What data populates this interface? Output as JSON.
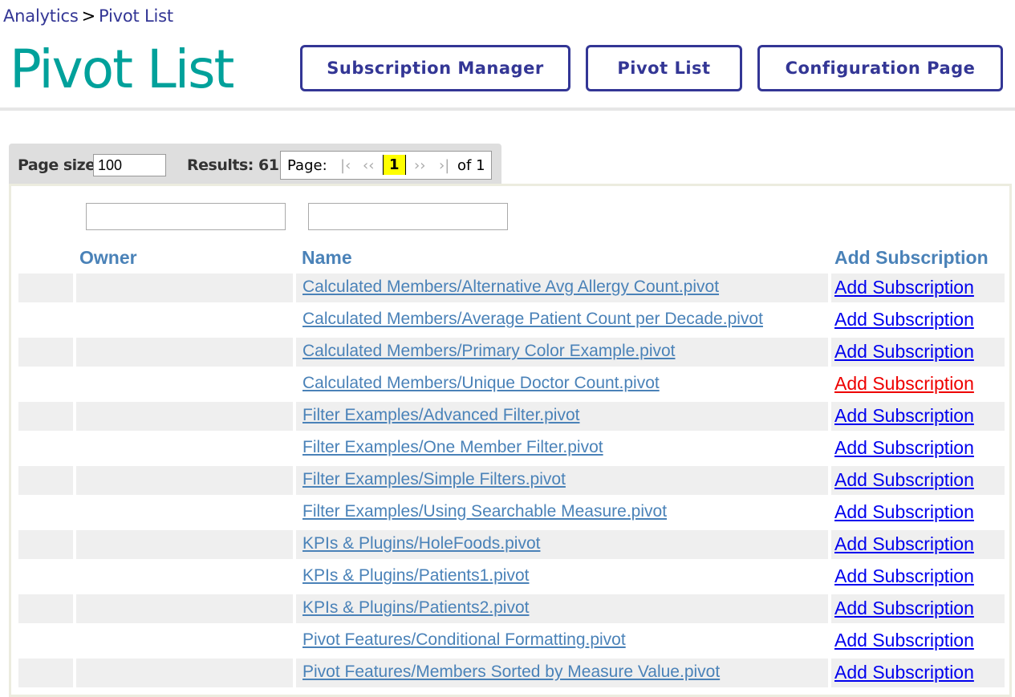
{
  "breadcrumb": {
    "root": "Analytics",
    "separator": ">",
    "current": "Pivot List"
  },
  "page_title": "Pivot List",
  "nav_buttons": {
    "subscription_manager": "Subscription Manager",
    "pivot_list": "Pivot List",
    "configuration_page": "Configuration Page"
  },
  "toolbar": {
    "page_size_label": "Page size:",
    "page_size_value": "100",
    "results_label": "Results: 61",
    "pager": {
      "label": "Page:",
      "first": "|‹",
      "prev": "‹‹",
      "current": "1",
      "next": "››",
      "last": "›|",
      "total": "of 1"
    }
  },
  "table": {
    "headers": {
      "owner": "Owner",
      "name": "Name",
      "add_subscription": "Add Subscription"
    },
    "rows": [
      {
        "name": "Calculated Members/Alternative Avg Allergy Count.pivot",
        "action": "Add Subscription"
      },
      {
        "name": "Calculated Members/Average Patient Count per Decade.pivot",
        "action": "Add Subscription"
      },
      {
        "name": "Calculated Members/Primary Color Example.pivot",
        "action": "Add Subscription"
      },
      {
        "name": "Calculated Members/Unique Doctor Count.pivot",
        "action": "Add Subscription"
      },
      {
        "name": "Filter Examples/Advanced Filter.pivot",
        "action": "Add Subscription"
      },
      {
        "name": "Filter Examples/One Member Filter.pivot",
        "action": "Add Subscription"
      },
      {
        "name": "Filter Examples/Simple Filters.pivot",
        "action": "Add Subscription"
      },
      {
        "name": "Filter Examples/Using Searchable Measure.pivot",
        "action": "Add Subscription"
      },
      {
        "name": "KPIs & Plugins/HoleFoods.pivot",
        "action": "Add Subscription"
      },
      {
        "name": "KPIs & Plugins/Patients1.pivot",
        "action": "Add Subscription"
      },
      {
        "name": "KPIs & Plugins/Patients2.pivot",
        "action": "Add Subscription"
      },
      {
        "name": "Pivot Features/Conditional Formatting.pivot",
        "action": "Add Subscription"
      },
      {
        "name": "Pivot Features/Members Sorted by Measure Value.pivot",
        "action": "Add Subscription"
      }
    ]
  },
  "colors": {
    "brand_teal": "#00a19b",
    "nav_indigo": "#333695",
    "link_blue": "#4a82b8",
    "action_link": "#0000ee",
    "action_link_hover": "#ee0000",
    "pager_highlight": "#ffff00"
  }
}
